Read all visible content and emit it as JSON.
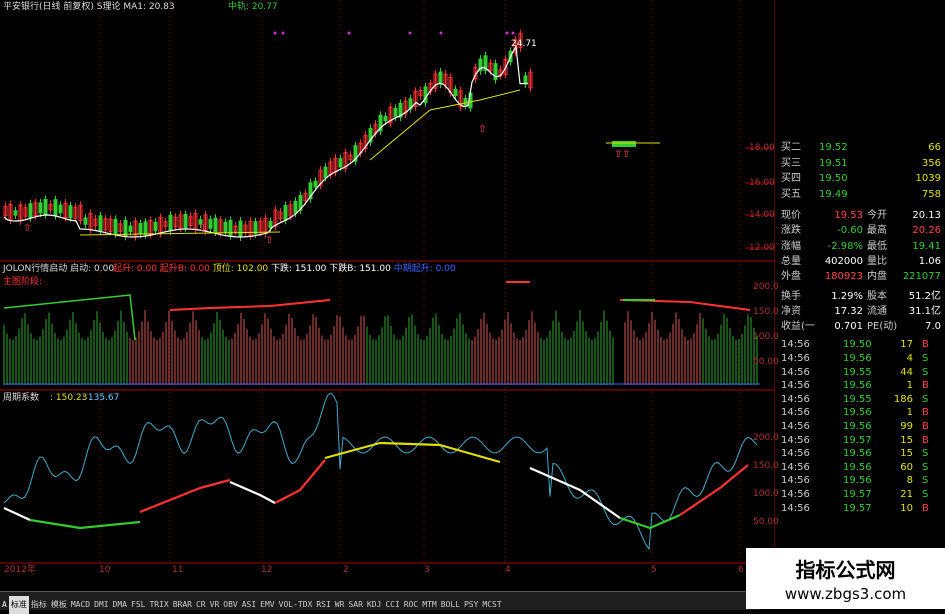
{
  "header": {
    "title": "平安银行(日线 前复权) S理论 MA1: 20.83",
    "center_label": "中轨: 20.77"
  },
  "price_labels": {
    "high": "24.71",
    "ticks": [
      "18.00",
      "16.00",
      "14.00",
      "12.00"
    ]
  },
  "indicator1": {
    "title": "JOLON行情启动 启动: 0.00",
    "items": [
      {
        "text": "起升: 0.00",
        "color": "#ff3333"
      },
      {
        "text": "起升B: 0.00",
        "color": "#ff3333"
      },
      {
        "text": "顶位: 102.00",
        "color": "#e0e000"
      },
      {
        "text": "下跌: 151.00",
        "color": "#ffffff"
      },
      {
        "text": "下跌B: 151.00",
        "color": "#ffffff"
      },
      {
        "text": "中期起升: 0.00",
        "color": "#3366ff"
      }
    ],
    "sub_label": "主图阶段:",
    "ticks": [
      "200.0",
      "150.0",
      "100.0",
      "50.00"
    ]
  },
  "indicator2": {
    "title": "周期系数",
    "v1": ": 150.23",
    "v2": ": 135.67",
    "ticks": [
      "200.0",
      "150.0",
      "100.0",
      "50.00"
    ]
  },
  "x_axis": [
    "2012年",
    "10",
    "11",
    "12",
    "2",
    "3",
    "4",
    "5",
    "6"
  ],
  "quote": {
    "bids": [
      {
        "label": "买二",
        "price": "19.52",
        "vol": "66"
      },
      {
        "label": "买三",
        "price": "19.51",
        "vol": "356"
      },
      {
        "label": "买四",
        "price": "19.50",
        "vol": "1039"
      },
      {
        "label": "买五",
        "price": "19.49",
        "vol": "758"
      }
    ],
    "stats": [
      {
        "l1": "现价",
        "v1": "19.53",
        "l2": "今开",
        "v2": "20.13",
        "c1": "#ff4444",
        "c2": "#ffffff"
      },
      {
        "l1": "涨跌",
        "v1": "-0.60",
        "l2": "最高",
        "v2": "20.26",
        "c1": "#33cc33",
        "c2": "#ff4444"
      },
      {
        "l1": "涨幅",
        "v1": "-2.98%",
        "l2": "最低",
        "v2": "19.41",
        "c1": "#33cc33",
        "c2": "#33cc33"
      },
      {
        "l1": "总量",
        "v1": "402000",
        "l2": "量比",
        "v2": "1.06",
        "c1": "#ffffff",
        "c2": "#ffffff"
      },
      {
        "l1": "外盘",
        "v1": "180923",
        "l2": "内盘",
        "v2": "221077",
        "c1": "#ff4444",
        "c2": "#33cc33"
      },
      {
        "l1": "换手",
        "v1": "1.29%",
        "l2": "股本",
        "v2": "51.2亿",
        "c1": "#ffffff",
        "c2": "#ffffff"
      },
      {
        "l1": "净资",
        "v1": "17.32",
        "l2": "流通",
        "v2": "31.1亿",
        "c1": "#ffffff",
        "c2": "#ffffff"
      },
      {
        "l1": "收益(一",
        "v1": "0.701",
        "l2": "PE(动)",
        "v2": "7.0",
        "c1": "#ffffff",
        "c2": "#ffffff"
      }
    ],
    "ticks": [
      {
        "time": "14:56",
        "price": "19.50",
        "vol": "17",
        "side": "B"
      },
      {
        "time": "14:56",
        "price": "19.56",
        "vol": "4",
        "side": "S"
      },
      {
        "time": "14:56",
        "price": "19.55",
        "vol": "44",
        "side": "S"
      },
      {
        "time": "14:56",
        "price": "19.56",
        "vol": "1",
        "side": "B"
      },
      {
        "time": "14:56",
        "price": "19.55",
        "vol": "186",
        "side": "S"
      },
      {
        "time": "14:56",
        "price": "19.56",
        "vol": "1",
        "side": "B"
      },
      {
        "time": "14:56",
        "price": "19.56",
        "vol": "99",
        "side": "B"
      },
      {
        "time": "14:56",
        "price": "19.57",
        "vol": "15",
        "side": "B"
      },
      {
        "time": "14:56",
        "price": "19.56",
        "vol": "15",
        "side": "S"
      },
      {
        "time": "14:56",
        "price": "19.56",
        "vol": "60",
        "side": "S"
      },
      {
        "time": "14:56",
        "price": "19.56",
        "vol": "8",
        "side": "S"
      },
      {
        "time": "14:56",
        "price": "19.57",
        "vol": "21",
        "side": "S"
      },
      {
        "time": "14:56",
        "price": "19.57",
        "vol": "10",
        "side": "B"
      }
    ]
  },
  "tabs": [
    "A",
    "标准",
    "指标",
    "模板",
    "MACD",
    "DMI",
    "DMA",
    "FSL",
    "TRIX",
    "BRAR",
    "CR",
    "VR",
    "OBV",
    "ASI",
    "EMV",
    "VOL-TDX",
    "RSI",
    "WR",
    "SAR",
    "KDJ",
    "CCI",
    "ROC",
    "MTM",
    "BOLL",
    "PSY",
    "MCST"
  ],
  "watermark": {
    "title": "指标公式网",
    "url": "www.zbgs3.com"
  },
  "colors": {
    "up": "#ff3333",
    "down": "#33cc33",
    "axis": "#aa0000",
    "ma": "#ffffff"
  }
}
